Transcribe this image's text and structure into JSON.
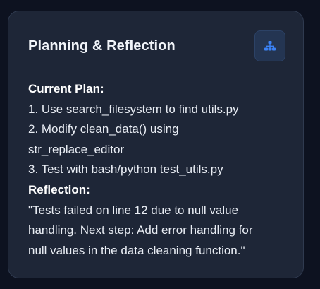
{
  "panel": {
    "title": "Planning & Reflection",
    "icon": "sitemap-icon",
    "accent_color": "#3b82f6"
  },
  "plan": {
    "heading": "Current Plan:",
    "steps": [
      "1. Use search_filesystem to find utils.py",
      "2. Modify clean_data() using",
      "str_replace_editor",
      "3. Test with bash/python test_utils.py"
    ]
  },
  "reflection": {
    "heading": "Reflection:",
    "lines": [
      "\"Tests failed on line 12 due to null value",
      "handling. Next step: Add error handling for",
      "null values in the data cleaning function.\""
    ]
  }
}
